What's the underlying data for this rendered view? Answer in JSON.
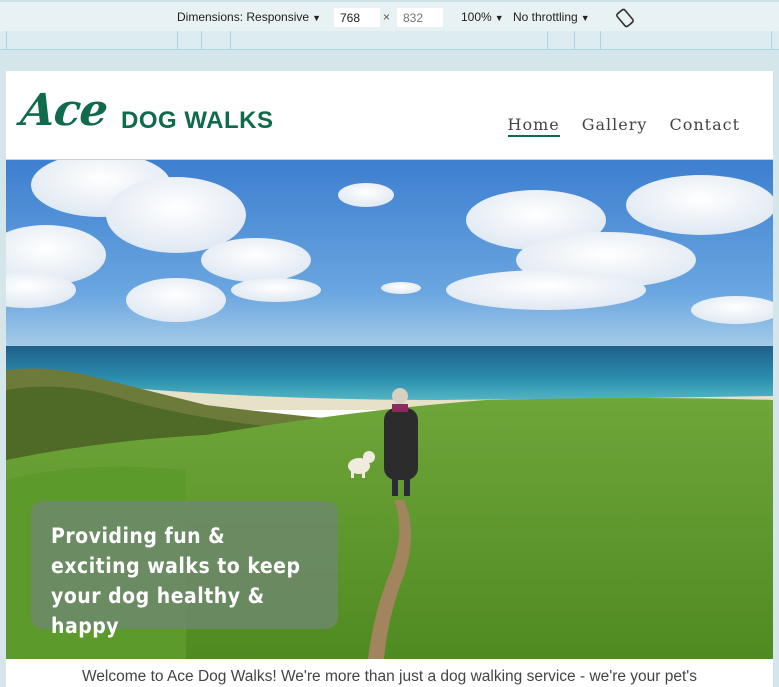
{
  "devtools": {
    "dimensions_label": "Dimensions: Responsive",
    "width_value": "768",
    "height_placeholder": "832",
    "times_sign": "×",
    "zoom_label": "100%",
    "throttling_label": "No throttling",
    "caret": "▼"
  },
  "site": {
    "logo_script": "Ace",
    "logo_text": "DOG WALKS",
    "nav": [
      {
        "label": "Home",
        "active": true
      },
      {
        "label": "Gallery",
        "active": false
      },
      {
        "label": "Contact",
        "active": false
      }
    ],
    "hero_text": "Providing fun & exciting walks to keep your dog healthy & happy",
    "intro_text": "Welcome to Ace Dog Walks! We're more than just a dog walking service - we're your pet's"
  },
  "colors": {
    "brand_green": "#0f6b4c",
    "hero_box": "#6e876e",
    "devtools_bg": "#e8f1f3"
  }
}
